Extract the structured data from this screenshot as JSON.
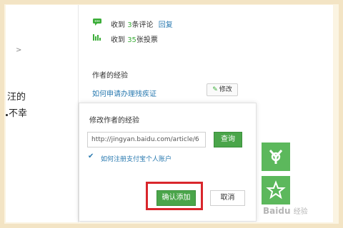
{
  "left": {
    "chevron": ">",
    "line1": "汪的",
    "line2": "不幸"
  },
  "stats": {
    "comments": {
      "prefix": "收到",
      "count": "3",
      "suffix": "条评论",
      "reply": "回复"
    },
    "votes": {
      "prefix": "收到",
      "count": "35",
      "suffix": "张投票"
    }
  },
  "author_exp": {
    "title": "作者的经验",
    "link": "如何申请办理残疾证",
    "edit_label": "修改"
  },
  "dialog": {
    "title": "修改作者的经验",
    "url_value": "http://jingyan.baidu.com/article/6",
    "query_label": "查询",
    "suggestion": "如何注册支付宝个人账户",
    "confirm_label": "确认添加",
    "cancel_label": "取消"
  },
  "watermark": {
    "brand": "Bai",
    "du": "du",
    "sub": "经验"
  },
  "colors": {
    "green": "#4aa54a",
    "link": "#2a7ab0",
    "highlight": "#d9262c",
    "frame": "#f3e4c4"
  },
  "icons": [
    "comment-icon",
    "bar-chart-icon",
    "pencil-icon",
    "check-icon",
    "share-icon",
    "star-icon"
  ]
}
